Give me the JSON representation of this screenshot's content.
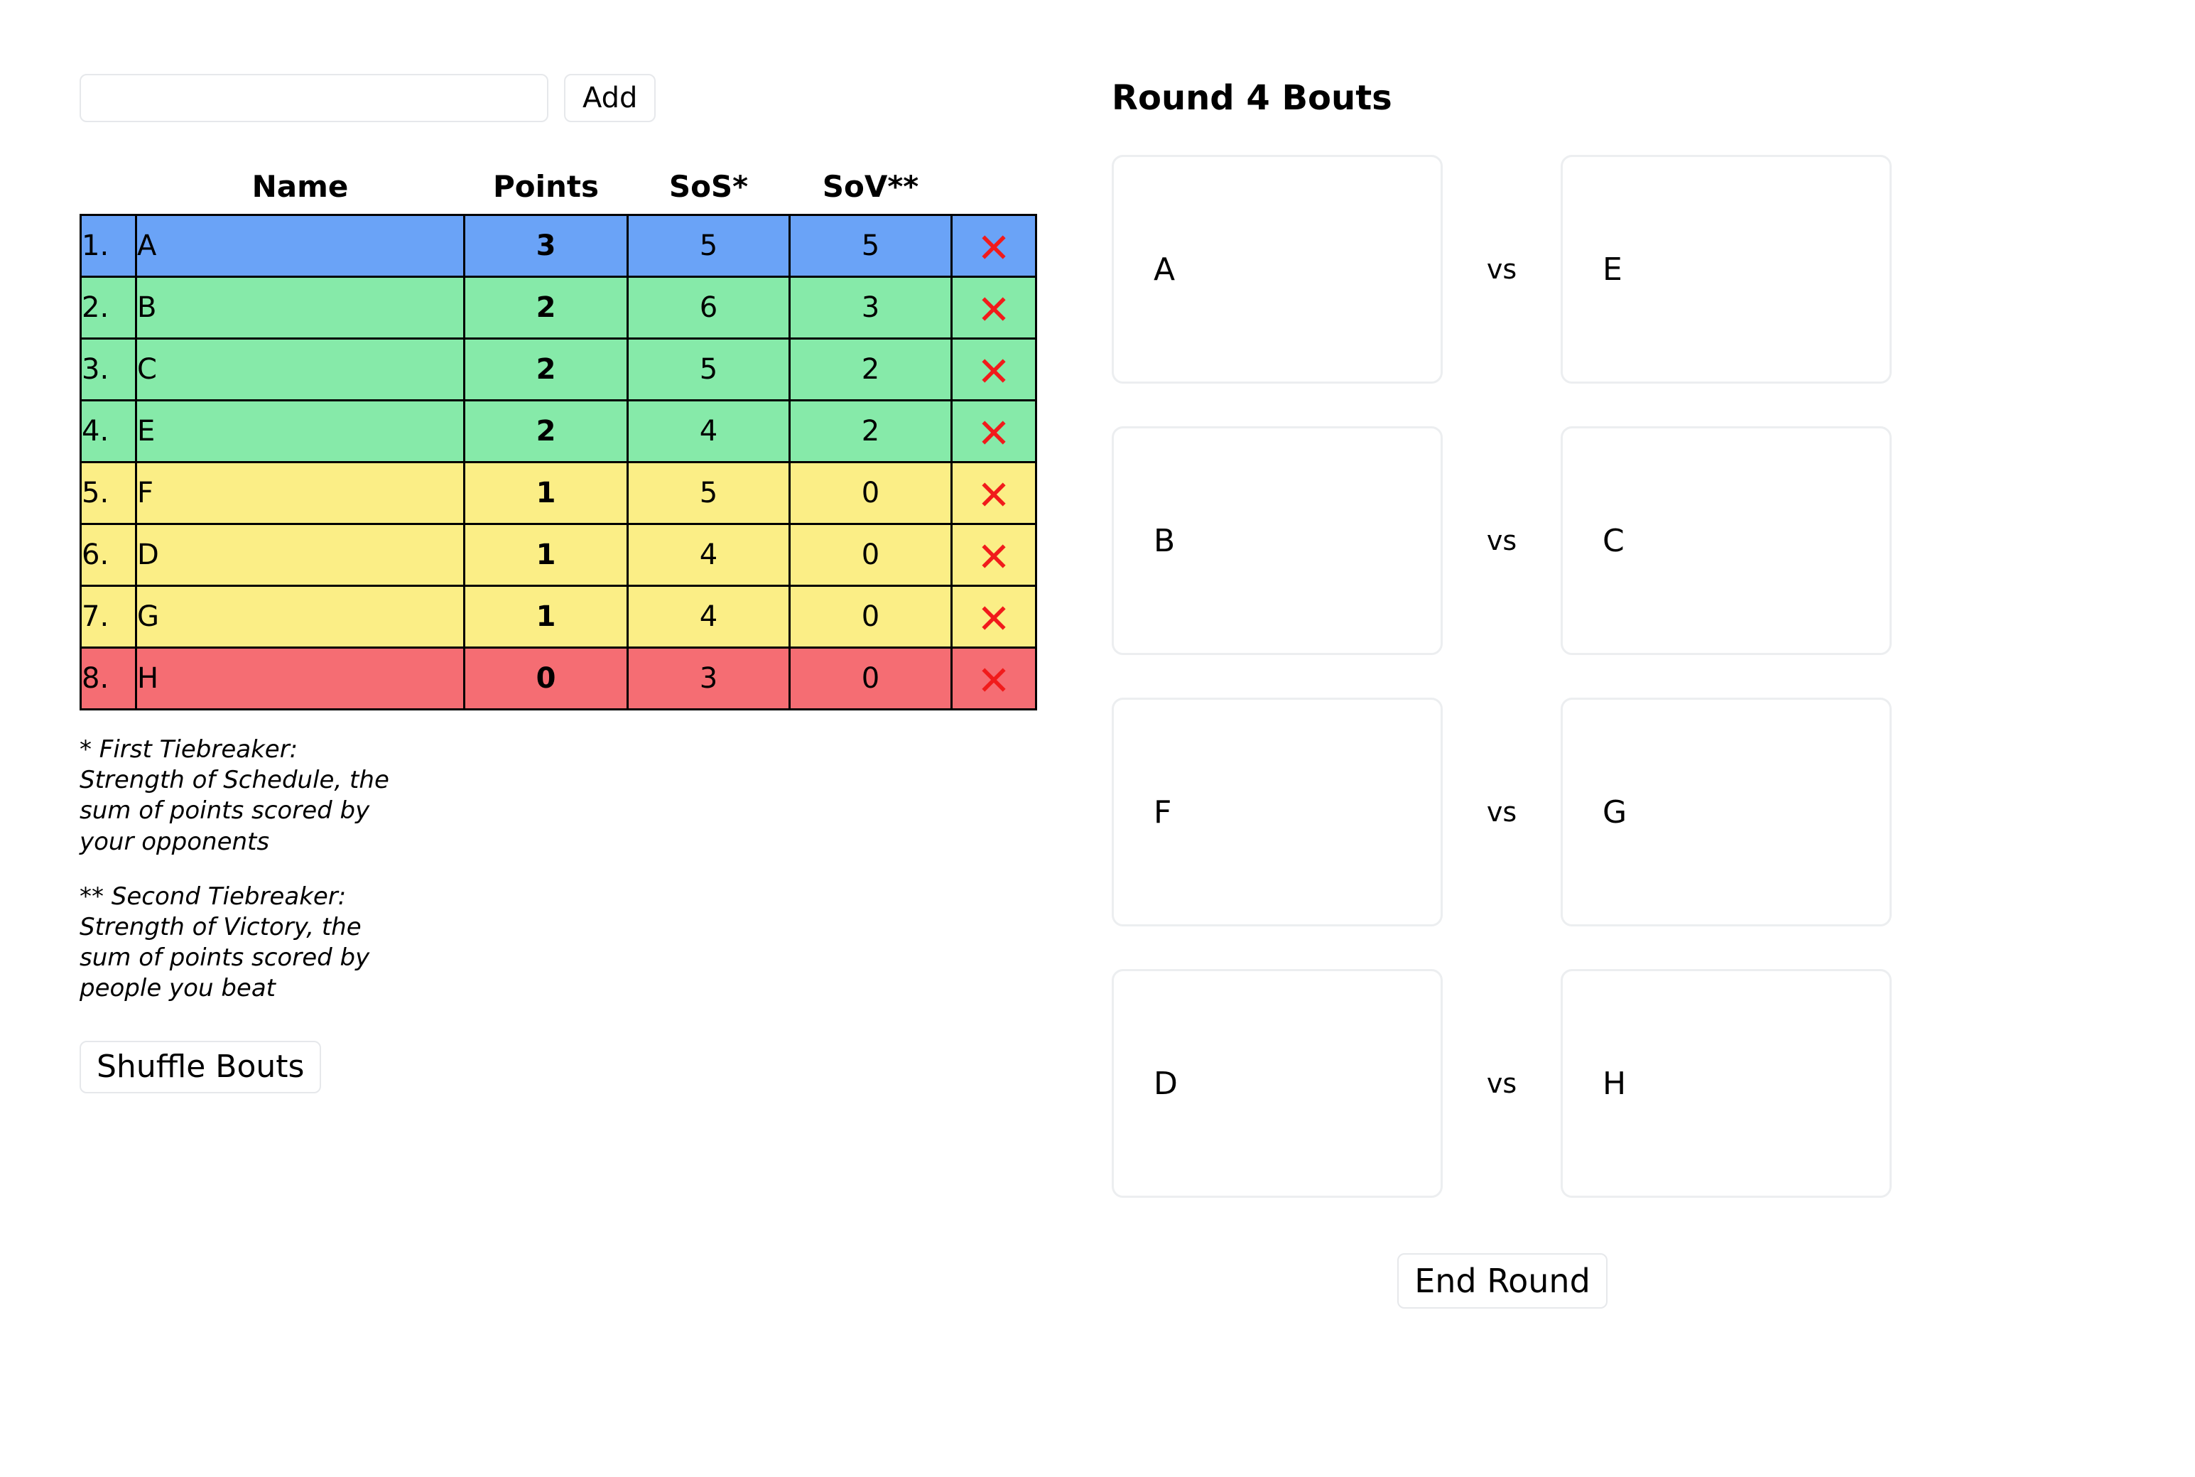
{
  "add_player": {
    "input_value": "",
    "input_placeholder": "",
    "add_label": "Add"
  },
  "standings": {
    "columns": [
      "",
      "Name",
      "Points",
      "SoS*",
      "SoV**",
      ""
    ],
    "rows": [
      {
        "rank": "1.",
        "name": "A",
        "points": "3",
        "sos": "5",
        "sov": "5",
        "tier": "blue",
        "delete_icon": "close-x-icon"
      },
      {
        "rank": "2.",
        "name": "B",
        "points": "2",
        "sos": "6",
        "sov": "3",
        "tier": "green",
        "delete_icon": "close-x-icon"
      },
      {
        "rank": "3.",
        "name": "C",
        "points": "2",
        "sos": "5",
        "sov": "2",
        "tier": "green",
        "delete_icon": "close-x-icon"
      },
      {
        "rank": "4.",
        "name": "E",
        "points": "2",
        "sos": "4",
        "sov": "2",
        "tier": "green",
        "delete_icon": "close-x-icon"
      },
      {
        "rank": "5.",
        "name": "F",
        "points": "1",
        "sos": "5",
        "sov": "0",
        "tier": "yellow",
        "delete_icon": "close-x-icon"
      },
      {
        "rank": "6.",
        "name": "D",
        "points": "1",
        "sos": "4",
        "sov": "0",
        "tier": "yellow",
        "delete_icon": "close-x-icon"
      },
      {
        "rank": "7.",
        "name": "G",
        "points": "1",
        "sos": "4",
        "sov": "0",
        "tier": "yellow",
        "delete_icon": "close-x-icon"
      },
      {
        "rank": "8.",
        "name": "H",
        "points": "0",
        "sos": "3",
        "sov": "0",
        "tier": "red",
        "delete_icon": "close-x-icon"
      }
    ],
    "tier_colors": {
      "blue": "#6aa3f7",
      "green": "#86eaa9",
      "yellow": "#fbee86",
      "red": "#f56d73"
    },
    "delete_icon_color": "#f11b1b"
  },
  "footnotes": {
    "first": "* First Tiebreaker: Strength of Schedule, the sum of points scored by your opponents",
    "second": "** Second Tiebreaker: Strength of Victory, the sum of points scored by people you beat"
  },
  "shuffle": {
    "label": "Shuffle Bouts"
  },
  "bouts_panel": {
    "title": "Round 4 Bouts",
    "vs_label": "vs",
    "bouts": [
      {
        "left": "A",
        "right": "E"
      },
      {
        "left": "B",
        "right": "C"
      },
      {
        "left": "F",
        "right": "G"
      },
      {
        "left": "D",
        "right": "H"
      }
    ],
    "end_round_label": "End Round"
  }
}
